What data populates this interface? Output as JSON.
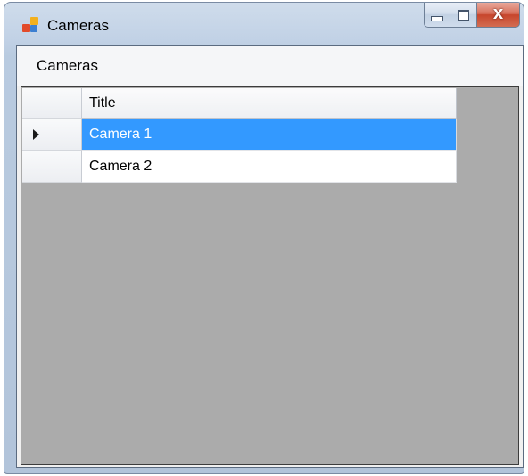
{
  "window": {
    "title": "Cameras",
    "icon": "windows-forms-app-icon",
    "caption_buttons": {
      "minimize_icon": "minimize-icon",
      "maximize_icon": "maximize-icon",
      "close_icon": "close-icon",
      "close_glyph": "X"
    }
  },
  "menubar": {
    "items": [
      {
        "label": "Cameras"
      }
    ]
  },
  "grid": {
    "columns": [
      {
        "header": "Title"
      }
    ],
    "rows": [
      {
        "title": "Camera 1",
        "selected": true,
        "current_row_icon": "current-row-arrow-icon"
      },
      {
        "title": "Camera 2",
        "selected": false
      }
    ],
    "selection_color": "#3399ff",
    "background_color": "#ababab"
  }
}
